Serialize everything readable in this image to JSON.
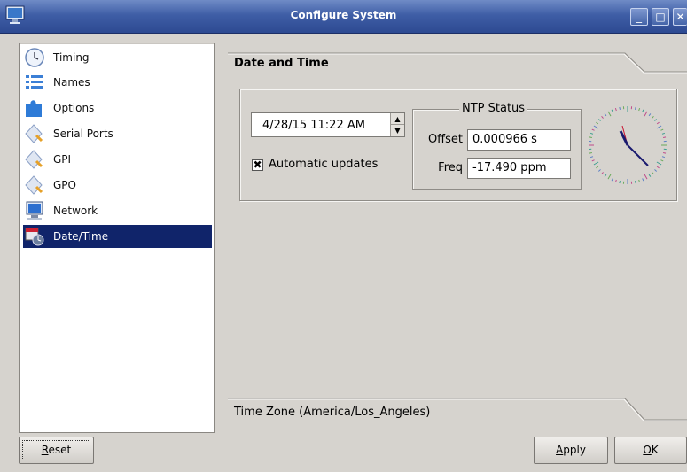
{
  "window": {
    "title": "Configure System"
  },
  "sidebar": {
    "items": [
      {
        "label": "Timing",
        "icon": "clock-icon"
      },
      {
        "label": "Names",
        "icon": "list-icon"
      },
      {
        "label": "Options",
        "icon": "puzzle-icon"
      },
      {
        "label": "Serial Ports",
        "icon": "diamond-plug-icon"
      },
      {
        "label": "GPI",
        "icon": "diamond-plug-icon"
      },
      {
        "label": "GPO",
        "icon": "diamond-plug-icon"
      },
      {
        "label": "Network",
        "icon": "monitor-icon"
      },
      {
        "label": "Date/Time",
        "icon": "calendar-clock-icon",
        "selected": true
      }
    ]
  },
  "main": {
    "section_title": "Date and Time",
    "datetime_value": "4/28/15 11:22 AM",
    "automatic_updates": {
      "label": "Automatic updates",
      "checked": true
    },
    "ntp": {
      "title": "NTP Status",
      "offset_label": "Offset",
      "offset_value": "0.000966 s",
      "freq_label": "Freq",
      "freq_value": "-17.490 ppm"
    },
    "timezone_text": "Time Zone  (America/Los_Angeles)"
  },
  "buttons": {
    "reset_pre": "",
    "reset_key": "R",
    "reset_post": "eset",
    "apply_pre": "",
    "apply_key": "A",
    "apply_post": "pply",
    "ok_pre": "",
    "ok_key": "O",
    "ok_post": "K"
  },
  "colors": {
    "selection": "#10246a",
    "titlebar": "#3f5ea6"
  }
}
